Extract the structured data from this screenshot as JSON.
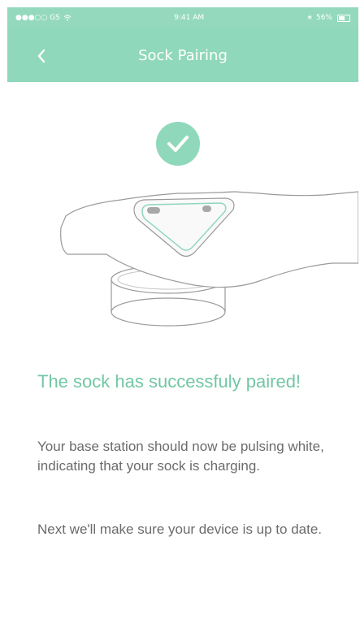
{
  "colors": {
    "accent": "#8fd8bb",
    "headline": "#72c7a4",
    "body_text": "#6b6b6b"
  },
  "status_bar": {
    "signal": "●●●○○ GS",
    "time": "9:41 AM",
    "battery": "56%"
  },
  "nav": {
    "back_icon": "chevron-left-icon",
    "title": "Sock Pairing"
  },
  "illustration": {
    "icons": [
      "checkmark-circle-icon",
      "sock-on-base-station-icon"
    ]
  },
  "main": {
    "headline": "The sock has successfuly paired!",
    "paragraph_1": "Your base station should now be pulsing white, indicating that your sock is charging.",
    "paragraph_2": "Next we'll make sure your device is up to date."
  }
}
